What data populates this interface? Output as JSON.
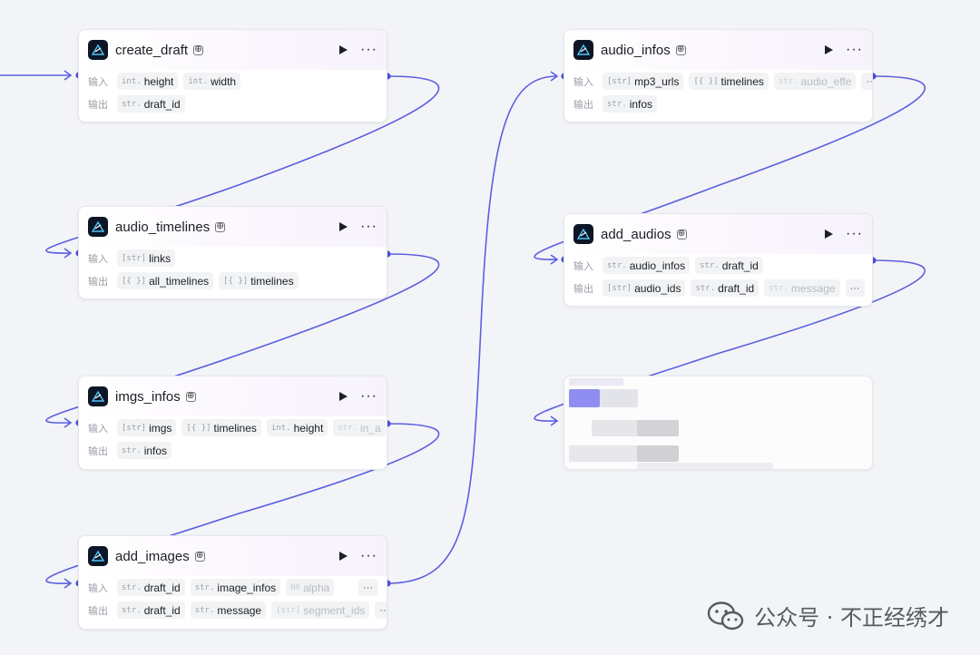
{
  "labels": {
    "input": "输入",
    "output": "输出",
    "more": "···",
    "overflow": "···"
  },
  "colors": {
    "edge": "#5b5fe0",
    "port": "#4d4fd8",
    "icon_bg": "#0c1626",
    "icon_accent": "#4fc3f7"
  },
  "nodes": [
    {
      "title": "create_draft",
      "inputs": [
        {
          "type": "int.",
          "name": "height"
        },
        {
          "type": "int.",
          "name": "width"
        }
      ],
      "outputs": [
        {
          "type": "str.",
          "name": "draft_id"
        }
      ]
    },
    {
      "title": "audio_timelines",
      "inputs": [
        {
          "type": "[str]",
          "name": "links"
        }
      ],
      "outputs": [
        {
          "type": "[{ }]",
          "name": "all_timelines"
        },
        {
          "type": "[{ }]",
          "name": "timelines"
        }
      ]
    },
    {
      "title": "imgs_infos",
      "inputs": [
        {
          "type": "[str]",
          "name": "imgs"
        },
        {
          "type": "[{ }]",
          "name": "timelines"
        },
        {
          "type": "int.",
          "name": "height"
        },
        {
          "type": "str.",
          "name": "in_a"
        }
      ],
      "outputs": [
        {
          "type": "str.",
          "name": "infos"
        }
      ]
    },
    {
      "title": "add_images",
      "inputs": [
        {
          "type": "str.",
          "name": "draft_id"
        },
        {
          "type": "str.",
          "name": "image_infos"
        },
        {
          "type": "N0",
          "name": "alpha"
        }
      ],
      "outputs": [
        {
          "type": "str.",
          "name": "draft_id"
        },
        {
          "type": "str.",
          "name": "message"
        },
        {
          "type": "[str]",
          "name": "segment_ids"
        }
      ]
    },
    {
      "title": "audio_infos",
      "inputs": [
        {
          "type": "[str]",
          "name": "mp3_urls"
        },
        {
          "type": "[{ }]",
          "name": "timelines"
        },
        {
          "type": "str.",
          "name": "audio_effe"
        }
      ],
      "outputs": [
        {
          "type": "str.",
          "name": "infos"
        }
      ]
    },
    {
      "title": "add_audios",
      "inputs": [
        {
          "type": "str.",
          "name": "audio_infos"
        },
        {
          "type": "str.",
          "name": "draft_id"
        }
      ],
      "outputs": [
        {
          "type": "[str]",
          "name": "audio_ids"
        },
        {
          "type": "str.",
          "name": "draft_id"
        },
        {
          "type": "str.",
          "name": "message"
        }
      ]
    }
  ],
  "watermark": {
    "text": "公众号 · 不正经绣才"
  }
}
